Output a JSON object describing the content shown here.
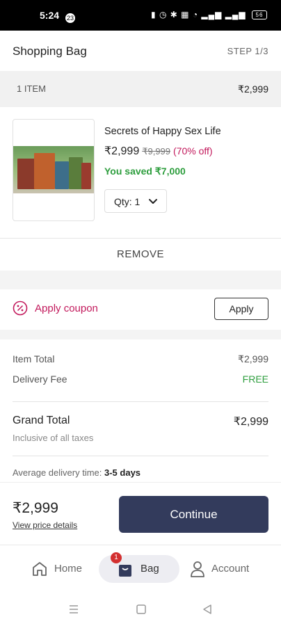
{
  "status_bar": {
    "time": "5:24",
    "notification_count": "23",
    "battery": "56"
  },
  "header": {
    "title": "Shopping Bag",
    "step": "STEP 1/3"
  },
  "item_bar": {
    "count": "1 ITEM",
    "total": "₹2,999"
  },
  "product": {
    "name": "Secrets of Happy Sex Life",
    "price": "₹2,999",
    "mrp": "₹9,999",
    "discount": "(70% off)",
    "saved": "You saved ₹7,000",
    "qty_label": "Qty: 1",
    "image_icon": "book-cover-image"
  },
  "remove_label": "REMOVE",
  "coupon": {
    "label": "Apply coupon",
    "button": "Apply",
    "icon": "coupon-percent-icon"
  },
  "summary": {
    "item_total_label": "Item Total",
    "item_total_value": "₹2,999",
    "delivery_label": "Delivery Fee",
    "delivery_value": "FREE",
    "grand_total_label": "Grand Total",
    "grand_total_value": "₹2,999",
    "tax_note": "Inclusive of all taxes",
    "avg_delivery_label": "Average delivery time:",
    "avg_delivery_value": "3-5 days"
  },
  "bottom_bar": {
    "amount": "₹2,999",
    "details_link": "View price details",
    "continue": "Continue"
  },
  "nav": {
    "home": "Home",
    "bag": "Bag",
    "bag_badge": "1",
    "account": "Account"
  },
  "colors": {
    "accent": "#c2185b",
    "success": "#2e9e3e",
    "primary_button": "#333b5c"
  }
}
